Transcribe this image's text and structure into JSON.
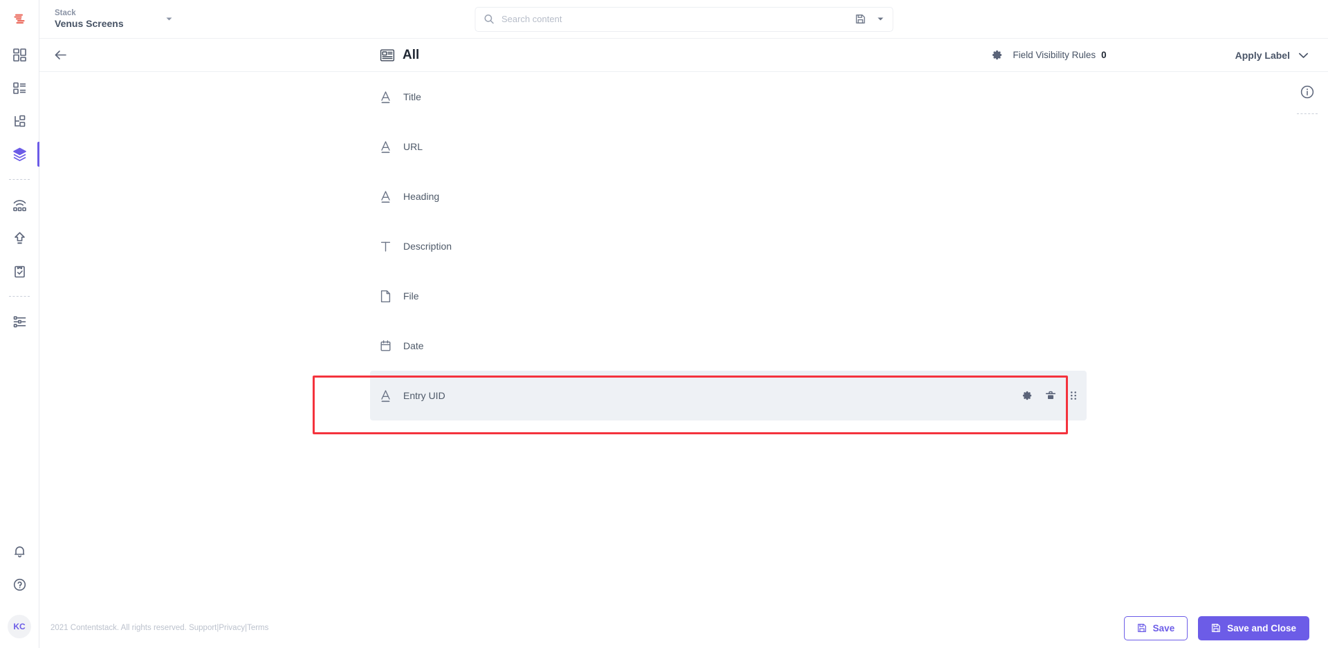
{
  "brand": {
    "logo_icon": "contentstack-logo",
    "accent_color": "#6c5ce7",
    "logo_color": "#ec6f62",
    "annotation_color": "#f4333d"
  },
  "topbar": {
    "stack_label": "Stack",
    "stack_name": "Venus Screens",
    "stack_caret_icon": "caret-down-icon",
    "search": {
      "placeholder": "Search content",
      "search_icon": "search-icon",
      "save_icon": "save-search-icon",
      "caret_icon": "caret-down-icon"
    }
  },
  "sidebar": {
    "items": [
      {
        "name": "dashboard",
        "icon": "dashboard-grid-icon",
        "active": false
      },
      {
        "name": "content-types",
        "icon": "content-types-icon",
        "active": false
      },
      {
        "name": "entries",
        "icon": "hierarchy-icon",
        "active": false
      },
      {
        "name": "stack",
        "icon": "layers-stack-icon",
        "active": true
      },
      {
        "name": "live-preview",
        "icon": "wifi-dots-icon",
        "active": false
      },
      {
        "name": "publish",
        "icon": "upload-publish-icon",
        "active": false
      },
      {
        "name": "tasks",
        "icon": "clipboard-check-icon",
        "active": false
      },
      {
        "name": "settings",
        "icon": "sliders-settings-icon",
        "active": false
      }
    ],
    "bottom_items": [
      {
        "name": "notifications",
        "icon": "bell-icon"
      },
      {
        "name": "help",
        "icon": "question-circle-icon"
      }
    ],
    "avatar_initials": "KC"
  },
  "page_header": {
    "back_icon": "arrow-left-icon",
    "title_icon": "content-type-page-icon",
    "title": "All",
    "gear_icon": "gear-icon",
    "field_visibility_rules_label": "Field Visibility Rules",
    "field_visibility_rules_count": "0",
    "apply_label": "Apply Label",
    "apply_label_caret_icon": "chevron-down-icon"
  },
  "info_panel": {
    "info_icon": "info-circle-icon"
  },
  "fields": [
    {
      "label": "Title",
      "icon": "single-line-text-icon",
      "selected": false
    },
    {
      "label": "URL",
      "icon": "single-line-text-icon",
      "selected": false
    },
    {
      "label": "Heading",
      "icon": "single-line-text-icon",
      "selected": false
    },
    {
      "label": "Description",
      "icon": "multi-line-text-icon",
      "selected": false
    },
    {
      "label": "File",
      "icon": "file-icon",
      "selected": false
    },
    {
      "label": "Date",
      "icon": "calendar-icon",
      "selected": false
    },
    {
      "label": "Entry UID",
      "icon": "single-line-text-icon",
      "selected": true
    }
  ],
  "row_actions": {
    "settings_icon": "gear-icon",
    "delete_icon": "trash-icon",
    "drag_icon": "drag-handle-icon"
  },
  "footer": {
    "copyright": "2021 Contentstack. All rights reserved.",
    "support_link": "Support",
    "privacy_link": "Privacy",
    "terms_link": "Terms",
    "separator": "|",
    "save_label": "Save",
    "save_icon": "floppy-disk-icon",
    "save_and_close_label": "Save and Close",
    "save_and_close_icon": "floppy-disk-icon"
  }
}
